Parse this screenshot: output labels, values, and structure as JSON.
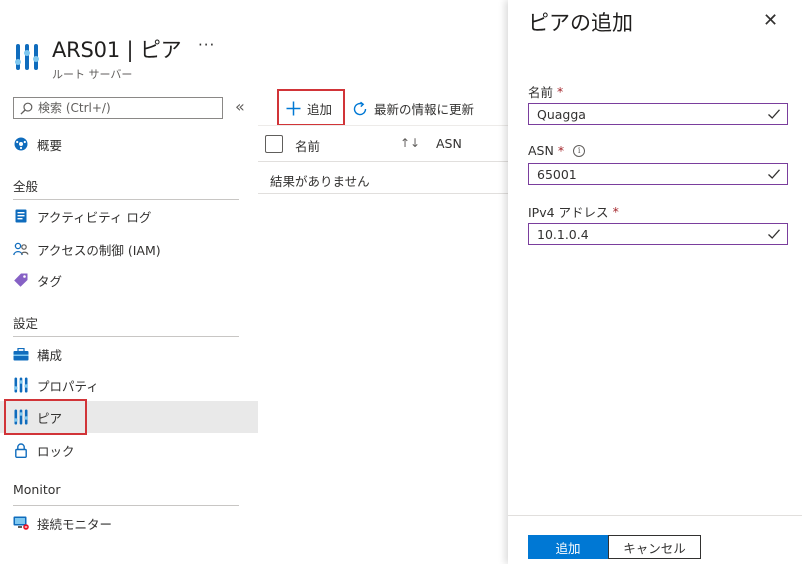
{
  "header": {
    "title": "ARS01 | ピア",
    "subtitle": "ルート サーバー",
    "more": "···",
    "icon": "route-server-icon"
  },
  "search": {
    "placeholder": "検索 (Ctrl+/)",
    "value": ""
  },
  "collapse_label": "«",
  "nav": {
    "overview": "概要",
    "section_general": "全般",
    "activity_log": "アクティビティ ログ",
    "iam": "アクセスの制御 (IAM)",
    "tags": "タグ",
    "section_settings": "設定",
    "configuration": "構成",
    "properties": "プロパティ",
    "peers": "ピア",
    "locks": "ロック",
    "section_monitor": "Monitor",
    "connection_monitor": "接続モニター"
  },
  "toolbar": {
    "add": "追加",
    "refresh": "最新の情報に更新"
  },
  "grid": {
    "col_name": "名前",
    "col_asn": "ASN",
    "sort_glyph": "↑↓",
    "empty": "結果がありません"
  },
  "panel": {
    "title": "ピアの追加",
    "close": "✕",
    "name_label": "名前",
    "name_value": "Quagga",
    "asn_label": "ASN",
    "asn_value": "65001",
    "ip_label": "IPv4 アドレス",
    "ip_value": "10.1.0.4",
    "required_mark": "*",
    "info_glyph": "i",
    "submit": "追加",
    "cancel": "キャンセル"
  },
  "colors": {
    "accent": "#0078d4",
    "highlight_box": "#d13438",
    "input_border": "#7a3e9d",
    "selected_nav": "#e9e9e9"
  }
}
